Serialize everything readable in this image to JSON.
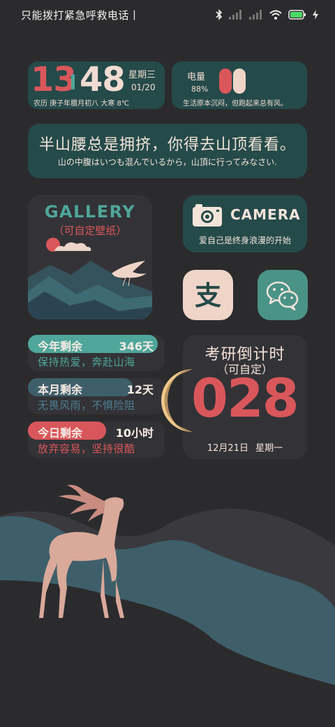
{
  "status_bar": {
    "text": "只能拨打紧急呼救电话丨",
    "icons": [
      "bluetooth-icon",
      "signal-icon",
      "signal-icon",
      "wifi-icon",
      "battery-icon",
      "charging-icon"
    ]
  },
  "clock": {
    "hour": "13",
    "minute": "48",
    "weekday": "星期三",
    "date": "01/20",
    "lunar": "农历 庚子年腊月初八 大寒 8℃"
  },
  "battery": {
    "label": "电量",
    "percent": "88%",
    "level": 0.88,
    "quote": "生活原本沉闷，但跑起来总有风。"
  },
  "quote": {
    "chinese": "半山腰总是拥挤，你得去山顶看看。",
    "japanese": "山の中腹はいつも混んでいるから，山頂に行ってみなさい."
  },
  "gallery": {
    "title": "GALLERY",
    "subtitle": "（可自定壁纸）"
  },
  "camera": {
    "label": "CAMERA",
    "subtitle": "爱自己是终身浪漫的开始",
    "icon": "camera-icon"
  },
  "apps": [
    {
      "name": "alipay",
      "icon": "alipay-icon",
      "glyph": "支"
    },
    {
      "name": "wechat",
      "icon": "wechat-icon"
    }
  ],
  "countdowns": [
    {
      "label": "今年剩余",
      "value": "346天",
      "motto": "保持热爱，奔赴山海"
    },
    {
      "label": "本月剩余",
      "value": "12天",
      "motto": "无畏风雨，不惧险阻"
    },
    {
      "label": "今日剩余",
      "value": "10小时",
      "motto": "放弃容易，坚持很酷"
    }
  ],
  "exam": {
    "title": "考研倒计时",
    "subtitle": "（可自定）",
    "days": "028",
    "date": "12月21日 星期一"
  },
  "colors": {
    "background": "#2b2b2d",
    "teal": "#4fa69a",
    "red": "#d9575a",
    "cream": "#f0dcd2",
    "widget_teal": "#254a4a",
    "widget_dark": "#333337"
  }
}
